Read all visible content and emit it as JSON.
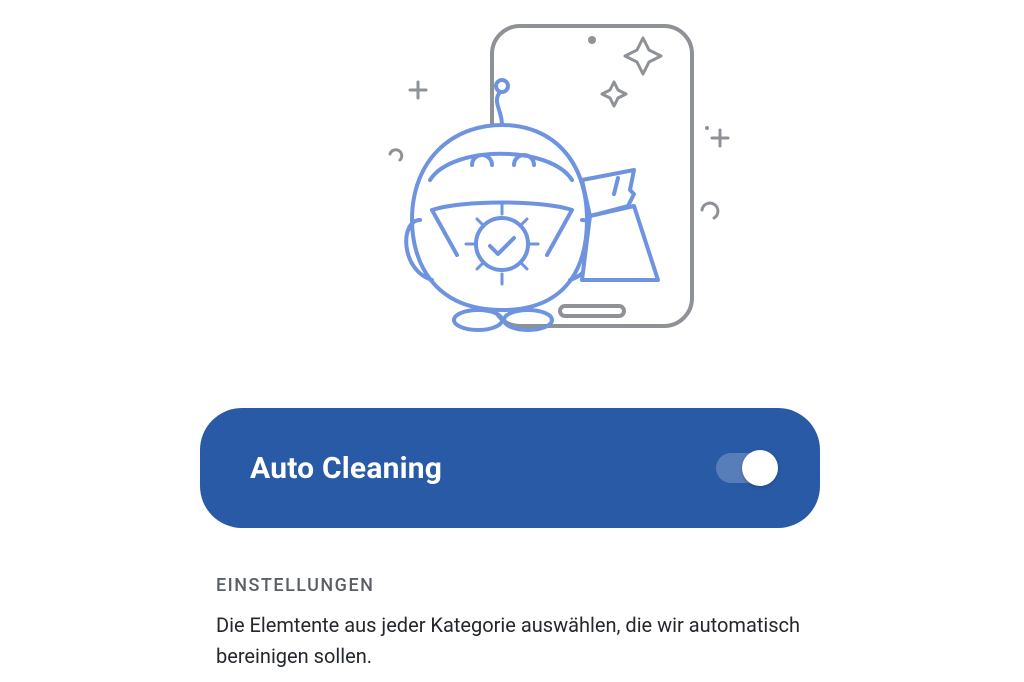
{
  "illustration": {
    "name": "auto-cleaning-illustration"
  },
  "card": {
    "title": "Auto Cleaning",
    "toggle": {
      "state": "on"
    }
  },
  "settings": {
    "heading": "EINSTELLUNGEN",
    "description": "Die Elemtente aus jeder Kategorie auswählen, die wir automatisch bereinigen sollen."
  },
  "colors": {
    "card_bg": "#295aa6",
    "robot_stroke": "#6e93df",
    "phone_stroke": "#8e9296"
  }
}
